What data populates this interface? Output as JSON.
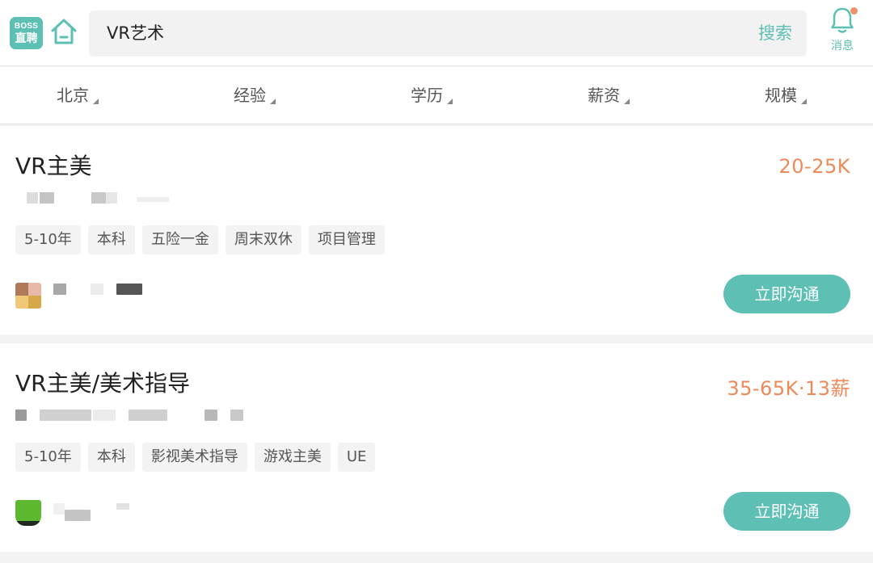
{
  "header": {
    "logo_line1": "BOSS",
    "logo_line2": "直聘",
    "search_value": "VR艺术",
    "search_button": "搜索",
    "messages_label": "消息",
    "has_unread": true
  },
  "filters": [
    {
      "label": "北京"
    },
    {
      "label": "经验"
    },
    {
      "label": "学历"
    },
    {
      "label": "薪资"
    },
    {
      "label": "规模"
    }
  ],
  "jobs": [
    {
      "title": "VR主美",
      "salary": "20-25K",
      "tags": [
        "5-10年",
        "本科",
        "五险一金",
        "周末双休",
        "项目管理"
      ],
      "action": "立即沟通"
    },
    {
      "title": "VR主美/美术指导",
      "salary": "35-65K·13薪",
      "tags": [
        "5-10年",
        "本科",
        "影视美术指导",
        "游戏主美",
        "UE"
      ],
      "action": "立即沟通"
    }
  ],
  "colors": {
    "accent": "#5ebfb4",
    "salary": "#ee8a5a",
    "tag_bg": "#f3f3f3",
    "page_bg": "#f3f3f3"
  }
}
